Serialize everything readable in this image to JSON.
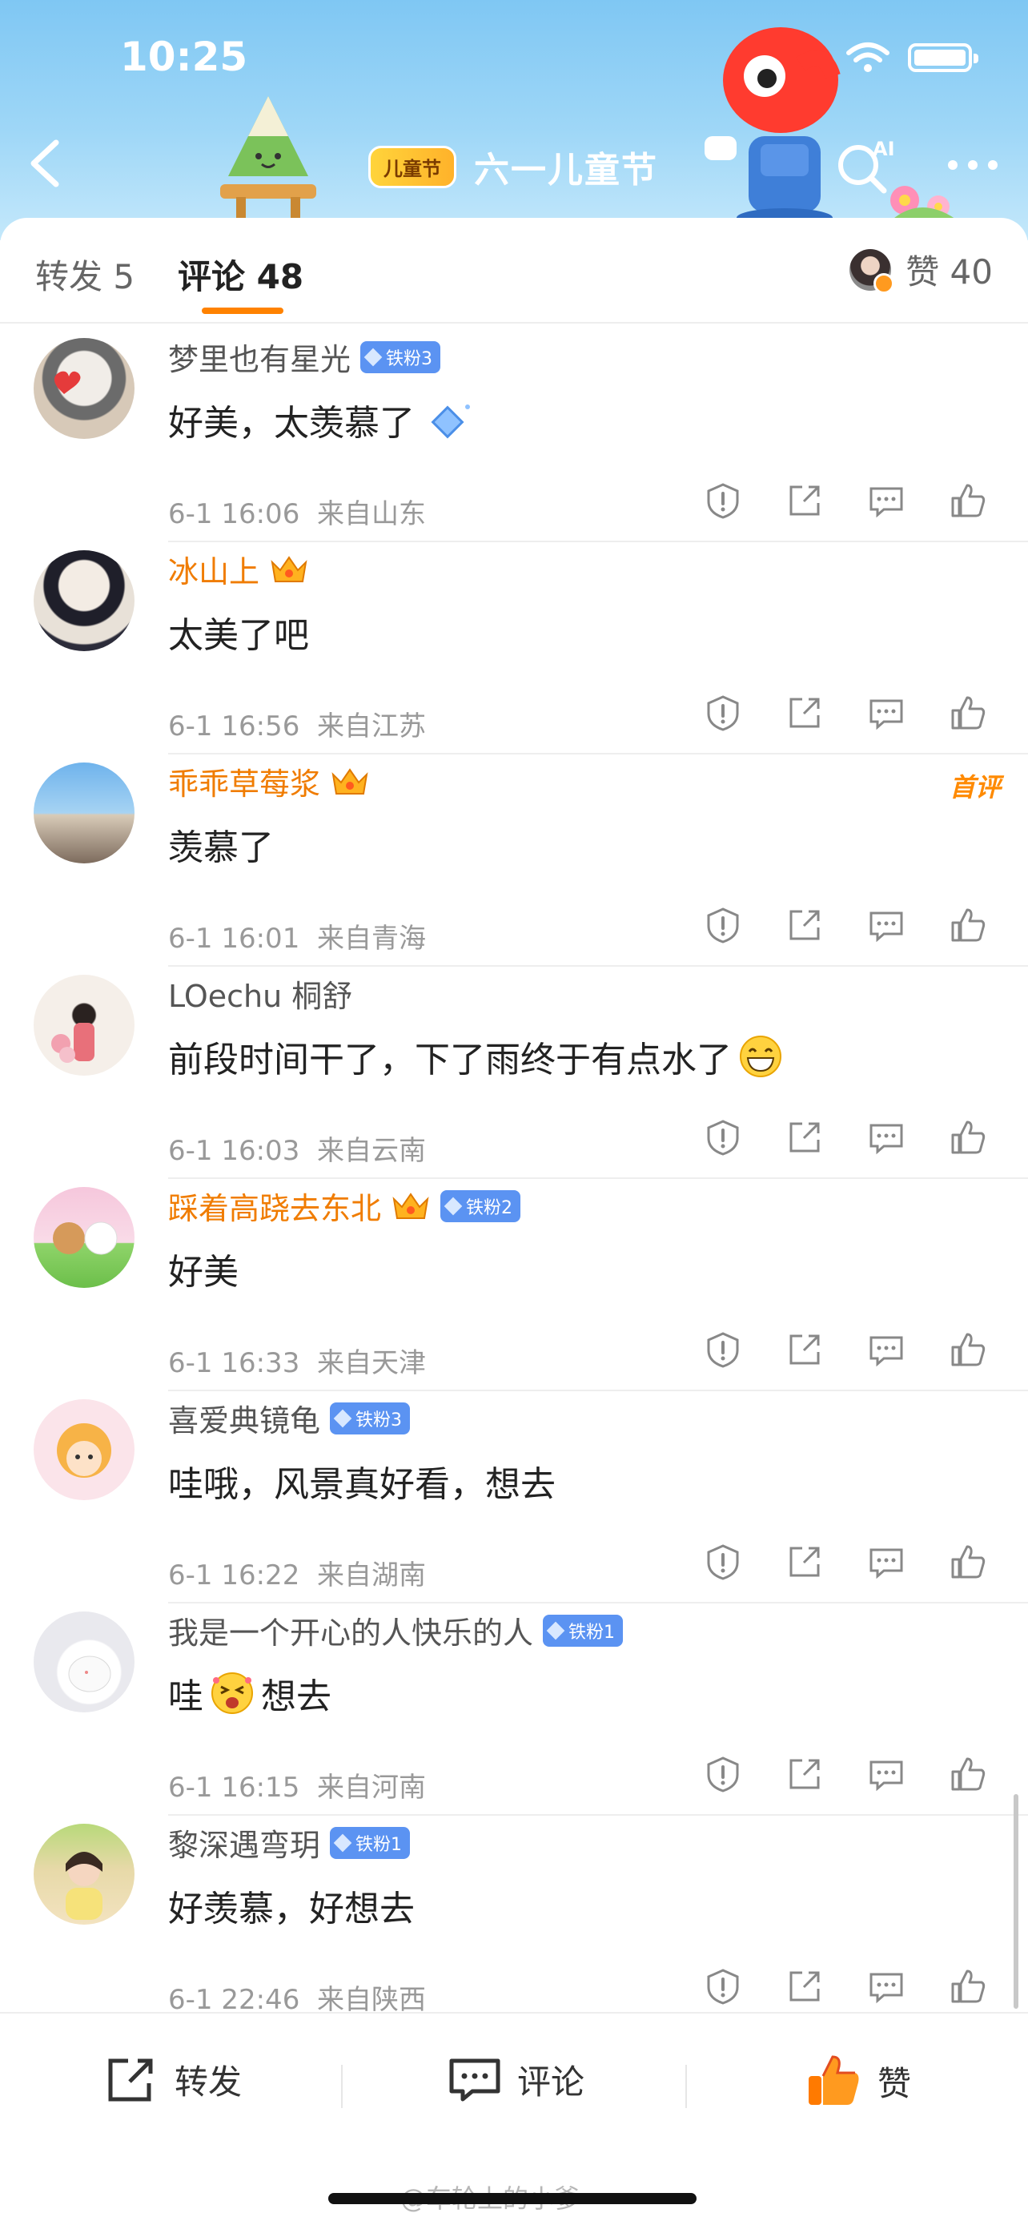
{
  "status_bar": {
    "time": "10:25"
  },
  "banner": {
    "badge_label": "儿童节",
    "title": "六一儿童节",
    "ai_label": "AI"
  },
  "tabs": {
    "repost": "转发 5",
    "comments": "评论 48",
    "likes": "赞 40"
  },
  "first_comment_label": "首评",
  "comments": [
    {
      "name": "梦里也有星光",
      "vip": false,
      "fan_badge": "铁粉3",
      "text": "好美，太羡慕了",
      "time": "6-1 16:06",
      "location": "来自山东"
    },
    {
      "name": "冰山上",
      "vip": true,
      "fan_badge": "",
      "text": "太美了吧",
      "time": "6-1 16:56",
      "location": "来自江苏"
    },
    {
      "name": "乖乖草莓浆",
      "vip": true,
      "fan_badge": "",
      "text": "羡慕了",
      "time": "6-1 16:01",
      "location": "来自青海",
      "first_comment": true
    },
    {
      "name": "LOechu 桐舒",
      "vip": false,
      "fan_badge": "",
      "text": "前段时间干了，下了雨终于有点水了",
      "time": "6-1 16:03",
      "location": "来自云南"
    },
    {
      "name": "踩着高跷去东北",
      "vip": true,
      "fan_badge": "铁粉2",
      "text": "好美",
      "time": "6-1 16:33",
      "location": "来自天津"
    },
    {
      "name": "喜爱典镜龟",
      "vip": false,
      "fan_badge": "铁粉3",
      "text": "哇哦，风景真好看，想去",
      "time": "6-1 16:22",
      "location": "来自湖南"
    },
    {
      "name": "我是一个开心的人快乐的人",
      "vip": false,
      "fan_badge": "铁粉1",
      "text_before": "哇",
      "text_after": "想去",
      "time": "6-1 16:15",
      "location": "来自河南"
    },
    {
      "name": "黎深遇弯玥",
      "vip": false,
      "fan_badge": "铁粉1",
      "text": "好羡慕，好想去",
      "time": "6-1 22:46",
      "location": "来自陕西"
    }
  ],
  "bottom_bar": {
    "repost": "转发",
    "comment": "评论",
    "like": "赞"
  },
  "watermark": "@车轮上的小爹",
  "colors": {
    "accent": "#ff8200",
    "vip_name": "#f07c00",
    "fan_badge": "#5b93f2",
    "meta": "#999999"
  }
}
